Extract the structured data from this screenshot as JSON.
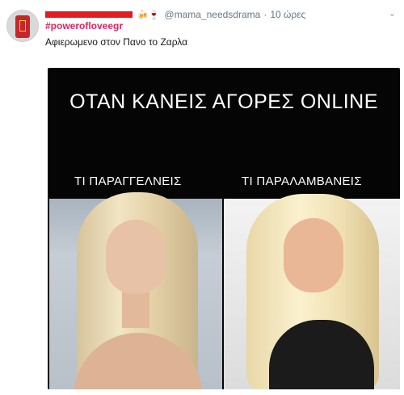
{
  "tweet": {
    "avatar_icon": "red-phone-booth-avatar",
    "display_name_redacted": true,
    "emoji": "🍻🍷",
    "handle": "@mama_needsdrama",
    "separator": "·",
    "time": "10 ώρες",
    "hashtag": "#powerofloveegr",
    "text": "Αφιερωμενο στον Πανο το Ζαρλα",
    "menu_icon": "chevron-down-icon"
  },
  "media": {
    "title": "ΟΤΑΝ ΚΑΝΕΙΣ ΑΓΟΡΕΣ ONLINE",
    "left_label": "ΤΙ ΠΑΡΑΓΓΕΛΝΕΙΣ",
    "right_label": "ΤΙ ΠΑΡΑΛΑΜΒΑΝΕΙΣ",
    "background": "#050505"
  }
}
